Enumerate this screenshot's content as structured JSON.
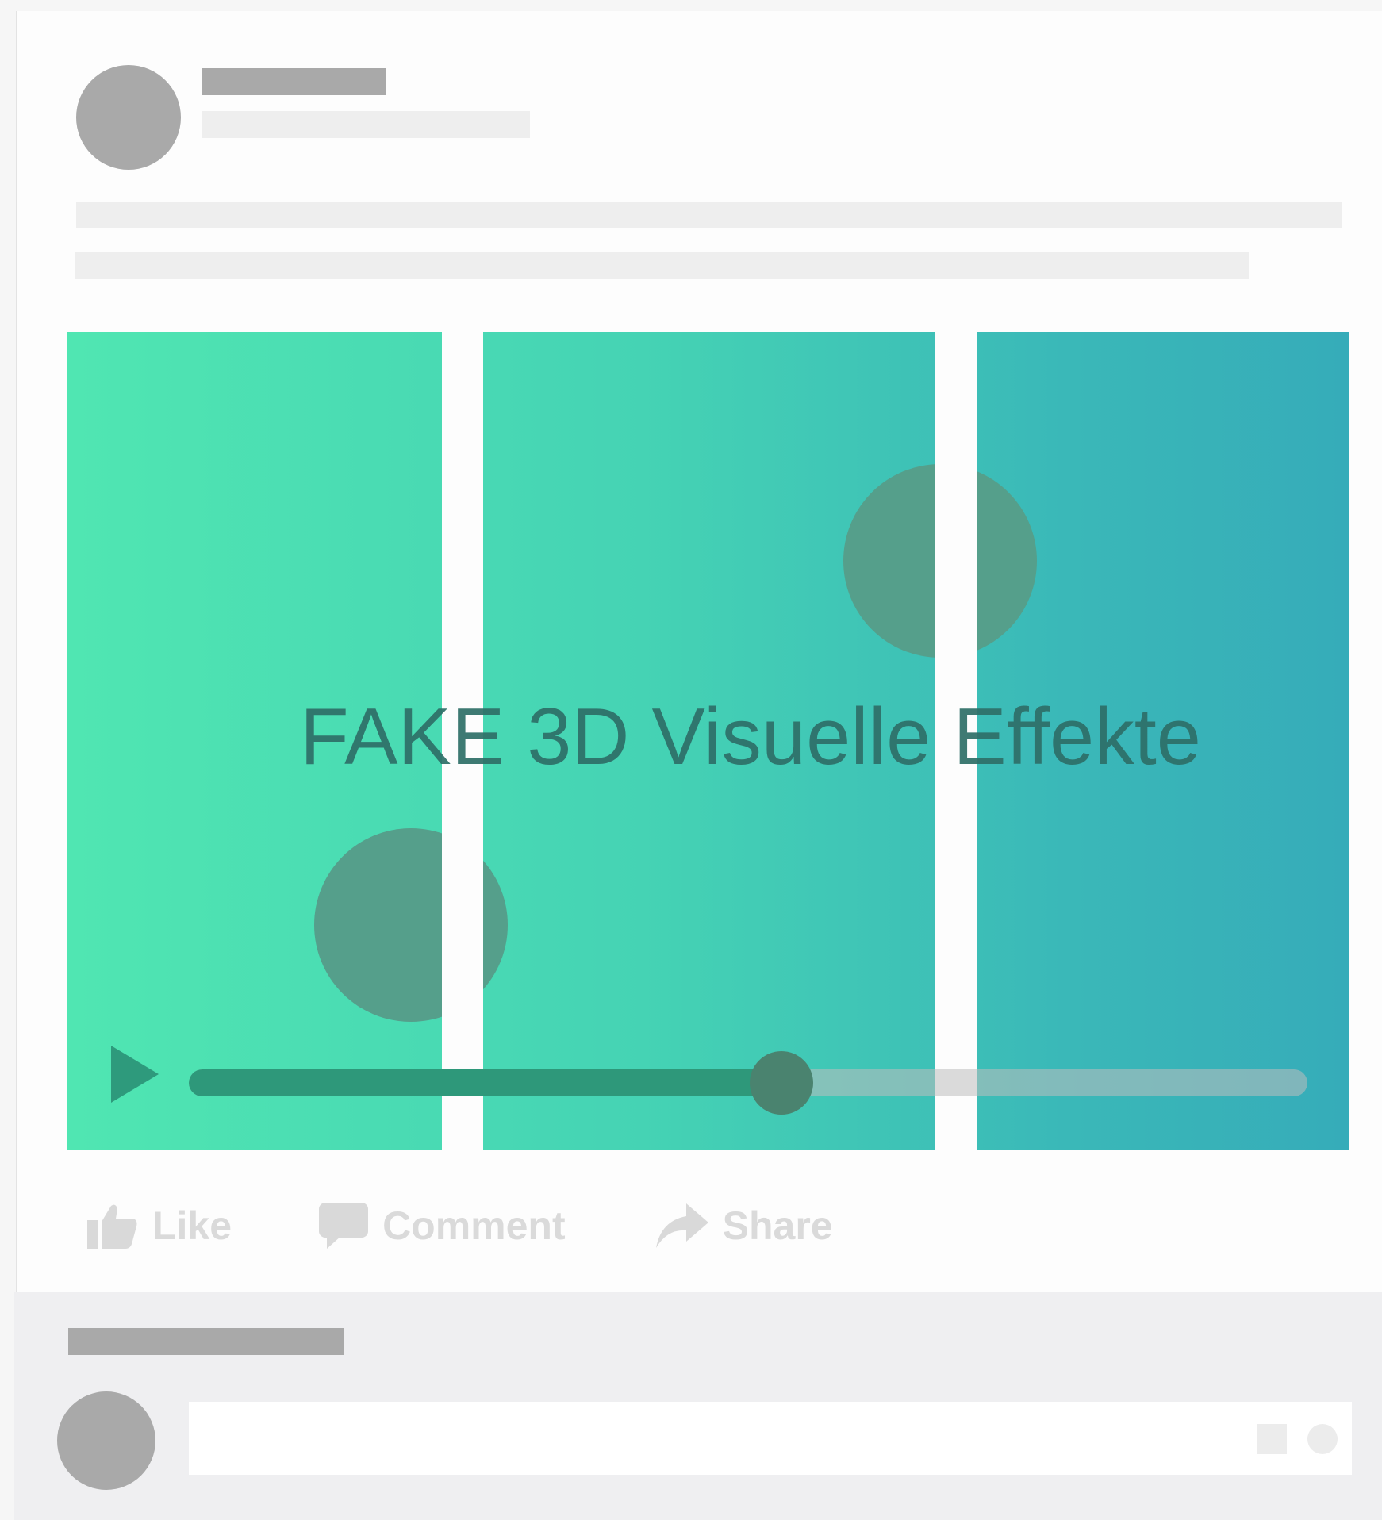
{
  "post": {
    "video": {
      "title": "FAKE 3D Visuelle Effekte",
      "progress": 0.53,
      "gradient": [
        "#50e6b2",
        "#36acb9"
      ],
      "blob_color": "#559f8b",
      "play_icon": "play-icon"
    },
    "actions": {
      "like": {
        "label": "Like",
        "icon": "thumbs-up-icon"
      },
      "comment": {
        "label": "Comment",
        "icon": "speech-bubble-icon"
      },
      "share": {
        "label": "Share",
        "icon": "share-arrow-icon"
      }
    },
    "placeholder_color": "#a9a9a9",
    "placeholder_light_color": "#eeeeee"
  },
  "comments": {
    "input": {
      "value": "",
      "attach_icons": [
        "square-icon",
        "circle-icon"
      ]
    }
  }
}
